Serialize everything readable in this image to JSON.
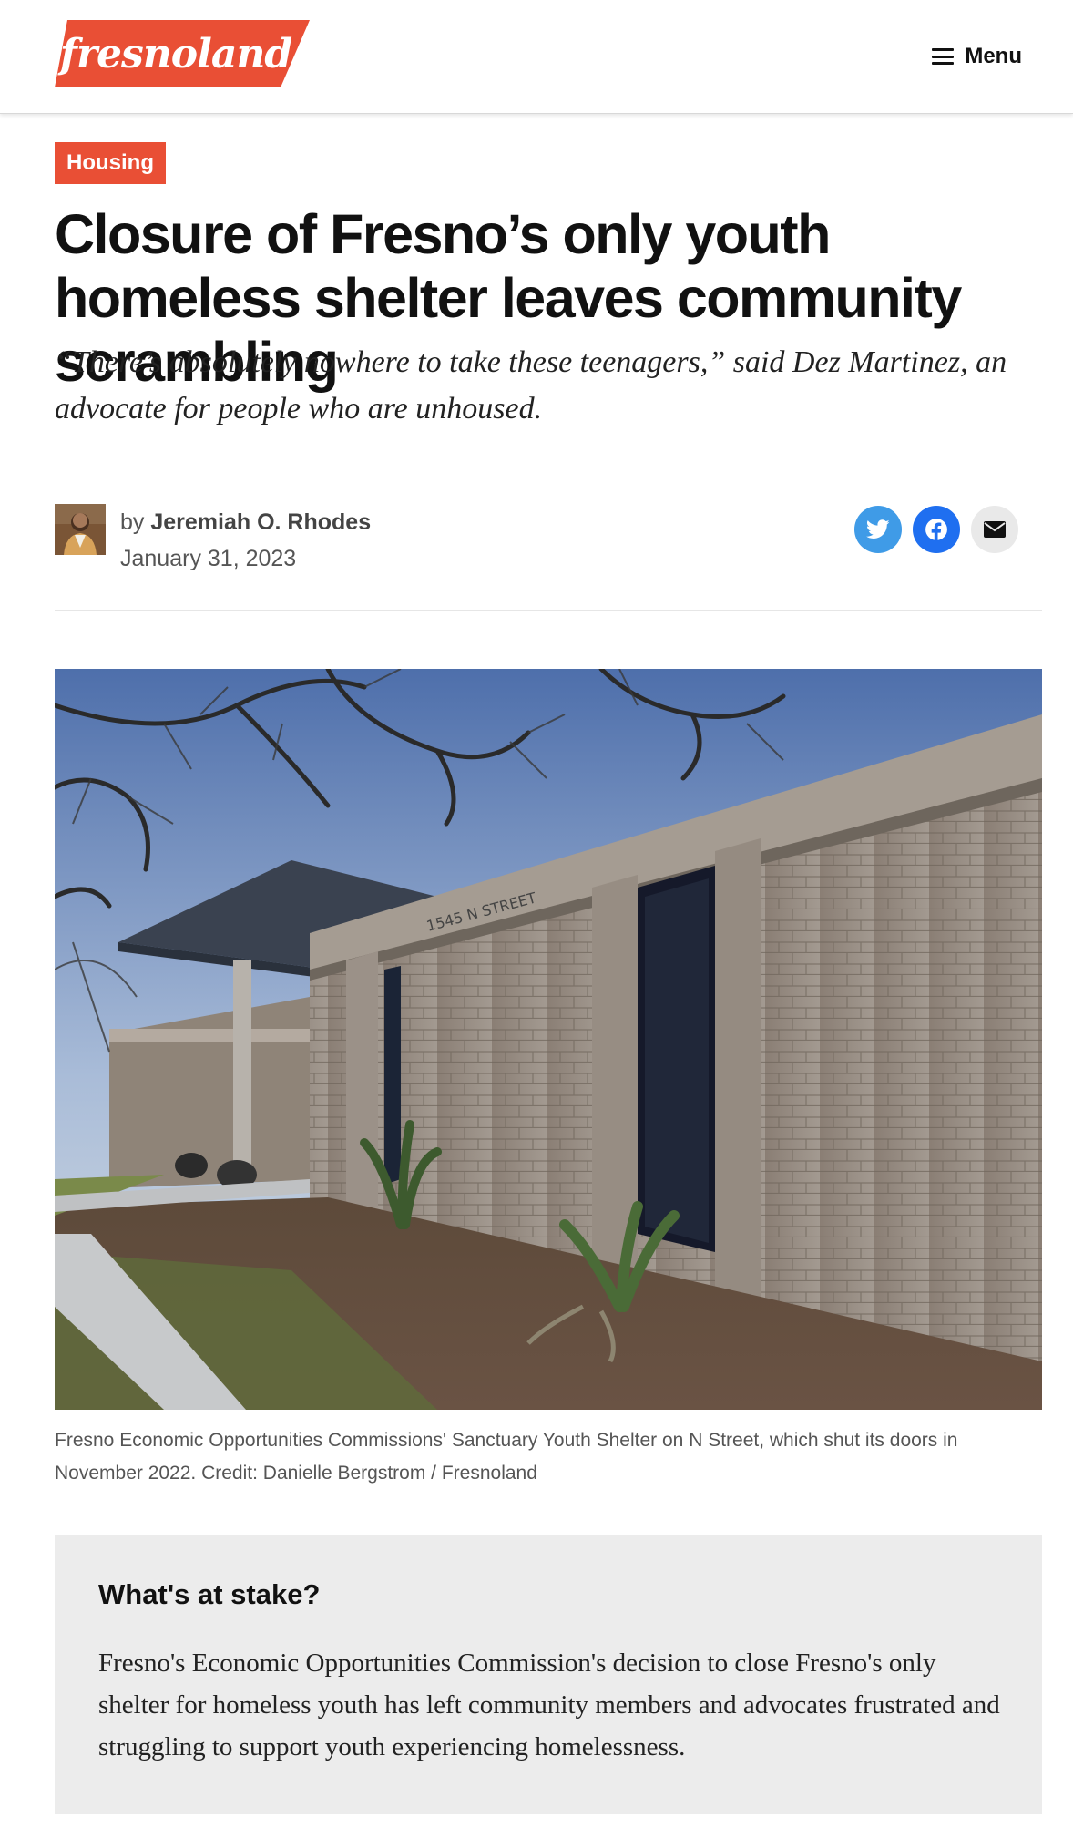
{
  "header": {
    "logo_text": "fresnoland",
    "menu_label": "Menu"
  },
  "colors": {
    "brand": "#e94f35",
    "twitter": "#3f9be7",
    "facebook": "#1f6ff0",
    "stake_bg": "#ececec"
  },
  "article": {
    "category": "Housing",
    "title": "Closure of Fresno’s only youth homeless shelter leaves community scrambling",
    "deck": "“There’s absolutely nowhere to take these teenagers,” said Dez Martinez, an advocate for people who are unhoused.",
    "byline_prefix": "by",
    "author": "Jeremiah O. Rhodes",
    "date": "January 31, 2023",
    "share_icons": [
      "twitter-icon",
      "facebook-icon",
      "email-icon"
    ],
    "photo_sign": "1545 N STREET",
    "caption": "Fresno Economic Opportunities Commissions' Sanctuary Youth Shelter on N Street, which shut its doors in November 2022. Credit: Danielle Bergstrom / Fresnoland"
  },
  "stake": {
    "title": "What's at stake?",
    "body": "Fresno's Economic Opportunities Commission's decision to close Fresno's only shelter for homeless youth has left community members and advocates frustrated and struggling to support youth experiencing homelessness."
  }
}
